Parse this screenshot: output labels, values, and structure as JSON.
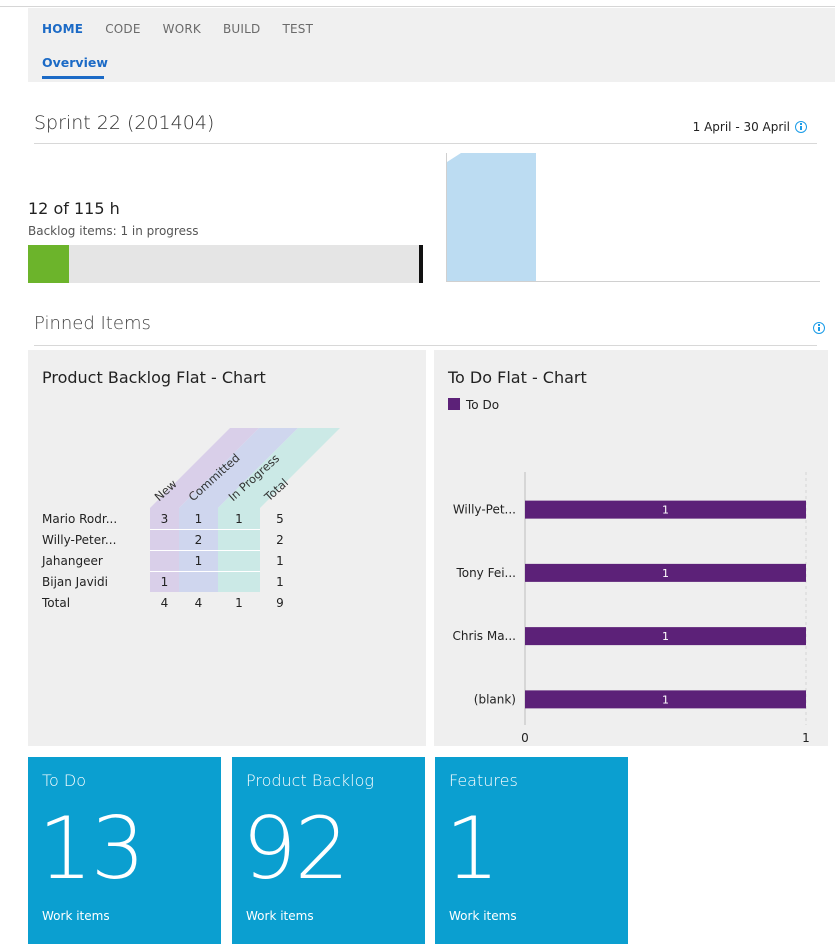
{
  "nav": {
    "tabs": [
      "HOME",
      "CODE",
      "WORK",
      "BUILD",
      "TEST"
    ],
    "active_tab": "HOME",
    "subtab": "Overview"
  },
  "sprint": {
    "title": "Sprint 22 (201404)",
    "dates": "1 April - 30 April",
    "hours": "12 of 115 h",
    "backlog_status": "Backlog items: 1 in progress",
    "progress_fraction": 0.104
  },
  "pinned": {
    "title": "Pinned Items"
  },
  "pivot_chart": {
    "title": "Product Backlog Flat - Chart",
    "columns": [
      "New",
      "Committed",
      "In Progress",
      "Total"
    ],
    "rows": [
      {
        "label": "Mario Rodr...",
        "values": [
          "3",
          "1",
          "1",
          "5"
        ]
      },
      {
        "label": "Willy-Peter...",
        "values": [
          "",
          "2",
          "",
          "2"
        ]
      },
      {
        "label": "Jahangeer",
        "values": [
          "",
          "1",
          "",
          "1"
        ]
      },
      {
        "label": "Bijan Javidi",
        "values": [
          "1",
          "",
          "",
          "1"
        ]
      },
      {
        "label": "Total",
        "values": [
          "4",
          "4",
          "1",
          "9"
        ]
      }
    ],
    "colors": [
      "#d9cfe9",
      "#cfd6ee",
      "#cbe9e6"
    ]
  },
  "chart_data": {
    "type": "bar",
    "title": "To Do Flat - Chart",
    "orientation": "horizontal",
    "categories": [
      "Willy-Pet...",
      "Tony Fei...",
      "Chris Ma...",
      "(blank)"
    ],
    "series": [
      {
        "name": "To Do",
        "values": [
          1,
          1,
          1,
          1
        ],
        "color": "#5c2178"
      }
    ],
    "xlim": [
      0,
      1
    ],
    "x_ticks": [
      "0",
      "1"
    ],
    "legend": "top-left"
  },
  "tiles": [
    {
      "title": "To Do",
      "count": "13",
      "sub": "Work items"
    },
    {
      "title": "Product Backlog",
      "count": "92",
      "sub": "Work items"
    },
    {
      "title": "Features",
      "count": "1",
      "sub": "Work items"
    }
  ]
}
